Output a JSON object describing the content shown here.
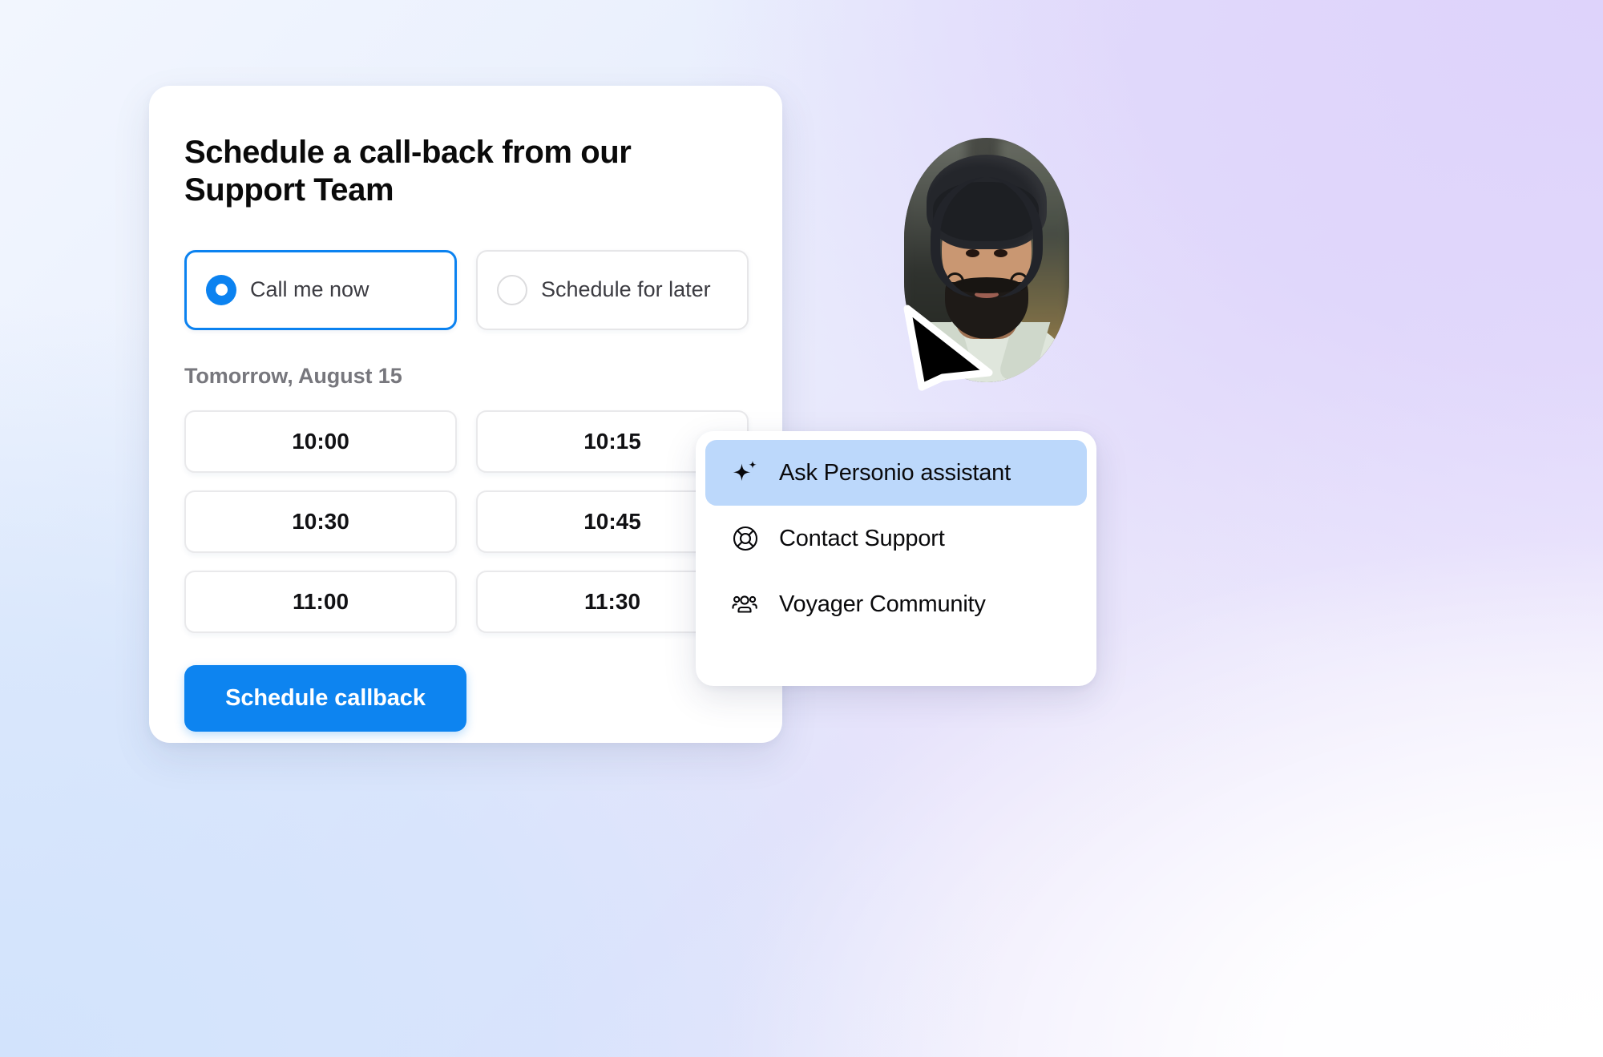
{
  "card": {
    "title": "Schedule a call-back from our Support Team",
    "options": [
      {
        "label": "Call me now",
        "selected": true
      },
      {
        "label": "Schedule for later",
        "selected": false
      }
    ],
    "date_label": "Tomorrow, August 15",
    "time_slots": [
      "10:00",
      "10:15",
      "10:30",
      "10:45",
      "11:00",
      "11:30"
    ],
    "submit_label": "Schedule callback",
    "accent_color": "#0d84f0"
  },
  "menu": {
    "items": [
      {
        "label": "Ask Personio assistant",
        "icon": "sparkle-icon",
        "active": true
      },
      {
        "label": "Contact Support",
        "icon": "lifebuoy-icon",
        "active": false
      },
      {
        "label": "Voyager Community",
        "icon": "people-group-icon",
        "active": false
      }
    ],
    "highlight_color": "#bcd8fb"
  },
  "avatar": {
    "name": "support-agent-avatar",
    "cursor": "pointer-cursor"
  }
}
